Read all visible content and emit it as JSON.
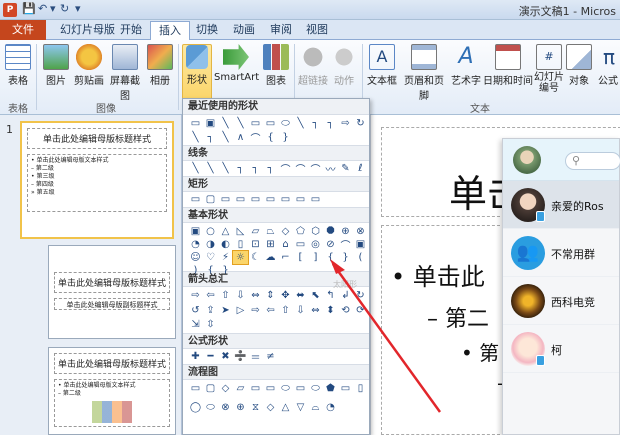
{
  "window": {
    "title": "演示文稿1 - Micros",
    "app_icon": "P"
  },
  "tabs": [
    {
      "label": "文件"
    },
    {
      "label": "幻灯片母版"
    },
    {
      "label": "开始"
    },
    {
      "label": "插入"
    },
    {
      "label": "切换"
    },
    {
      "label": "动画"
    },
    {
      "label": "审阅"
    },
    {
      "label": "视图"
    }
  ],
  "ribbon": {
    "buttons": [
      {
        "label": "表格"
      },
      {
        "label": "图片"
      },
      {
        "label": "剪贴画"
      },
      {
        "label": "屏幕截图"
      },
      {
        "label": "相册"
      },
      {
        "label": "形状"
      },
      {
        "label": "SmartArt"
      },
      {
        "label": "图表"
      },
      {
        "label": "超链接"
      },
      {
        "label": "动作"
      },
      {
        "label": "文本框"
      },
      {
        "label": "页眉和页脚"
      },
      {
        "label": "艺术字"
      },
      {
        "label": "日期和时间"
      },
      {
        "label": "幻灯片编号"
      },
      {
        "label": "对象"
      },
      {
        "label": "公式"
      }
    ],
    "groups": [
      {
        "label": "表格"
      },
      {
        "label": "图像"
      },
      {
        "label": "文本"
      }
    ]
  },
  "shape_menu": {
    "sections": [
      {
        "title": "最近使用的形状"
      },
      {
        "title": "线条"
      },
      {
        "title": "矩形"
      },
      {
        "title": "基本形状"
      },
      {
        "title": "箭头总汇"
      },
      {
        "title": "公式形状"
      },
      {
        "title": "流程图"
      }
    ],
    "tooltip": "太阳形"
  },
  "thumbnails": [
    {
      "number": "1",
      "title": "单击此处编辑母版标题样式",
      "body": [
        "• 单击此处编辑母版文本样式",
        "  – 第二级",
        "    • 第三级",
        "      – 第四级",
        "        » 第五级"
      ]
    },
    {
      "title": "单击此处编辑母版标题样式",
      "subtitle": "单击此处编辑母版副标题样式"
    },
    {
      "title": "单击此处编辑母版标题样式",
      "body": [
        "• 单击此处编辑母版文本样式",
        "  – 第二级"
      ]
    }
  ],
  "slide": {
    "title": "单击",
    "bullet1": "单击此",
    "bullet2": "第二",
    "bullet3": "第",
    "bullet_marker": "•",
    "level2_marker": "–"
  },
  "chat": {
    "items": [
      {
        "name": "亲爱的Ros"
      },
      {
        "name": "不常用群"
      },
      {
        "name": "西科电竞"
      },
      {
        "name": "柯"
      }
    ]
  },
  "colors": {
    "accent": "#c5461d",
    "arrow": "#e2262b",
    "highlight": "#fbd56a"
  }
}
